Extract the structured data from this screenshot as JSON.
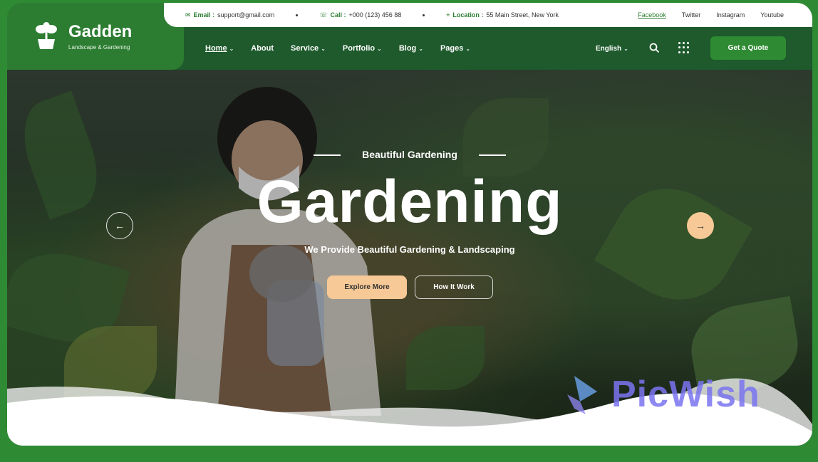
{
  "brand": {
    "name": "Gadden",
    "tagline": "Landscape & Gardening"
  },
  "topbar": {
    "email_label": "Email :",
    "email_value": "support@gmail.com",
    "call_label": "Call :",
    "call_value": "+000 (123) 456 88",
    "location_label": "Location :",
    "location_value": "55 Main Street, New York",
    "socials": [
      "Facebook",
      "Twitter",
      "Instagram",
      "Youtube"
    ]
  },
  "nav": {
    "items": [
      {
        "label": "Home",
        "dropdown": true
      },
      {
        "label": "About",
        "dropdown": false
      },
      {
        "label": "Service",
        "dropdown": true
      },
      {
        "label": "Portfolio",
        "dropdown": true
      },
      {
        "label": "Blog",
        "dropdown": true
      },
      {
        "label": "Pages",
        "dropdown": true
      }
    ],
    "language": "English",
    "cta": "Get a Quote"
  },
  "hero": {
    "eyebrow": "Beautiful Gardening",
    "title": "Gardening",
    "subtitle": "We Provide Beautiful Gardening & Landscaping",
    "primary_button": "Explore More",
    "secondary_button": "How It Work"
  },
  "watermark": {
    "text": "PicWish"
  },
  "icons": {
    "email": "envelope-icon",
    "call": "phone-icon",
    "location": "map-pin-icon",
    "search": "search-icon",
    "menu": "grid-menu-icon",
    "prev": "arrow-left-icon",
    "next": "arrow-right-icon"
  },
  "colors": {
    "brand": "#2c7d32",
    "nav_bg": "#1e5a2c",
    "accent": "#f6c996",
    "watermark": "#7a74f0"
  }
}
